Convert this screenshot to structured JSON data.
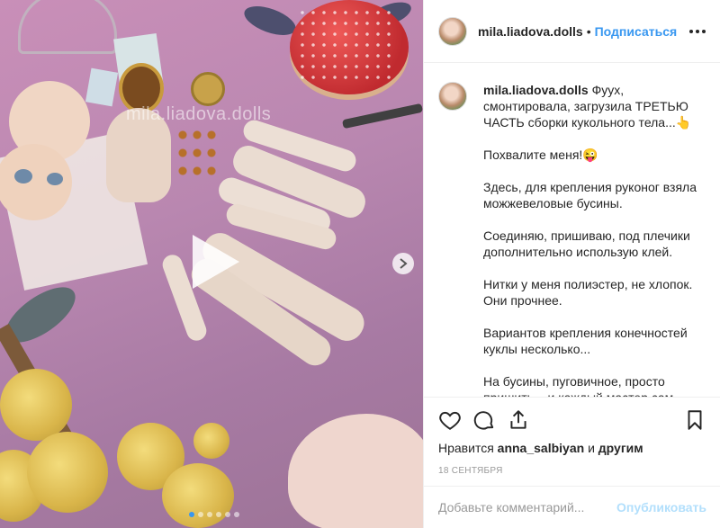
{
  "post": {
    "username": "mila.liadova.dolls",
    "separator": "•",
    "follow_label": "Подписаться",
    "more_icon": "more-horizontal-icon"
  },
  "media": {
    "watermark": "mila.liadova.dolls",
    "play_icon": "play-icon",
    "next_icon": "chevron-right-icon",
    "carousel_dots": 6,
    "active_dot": 1
  },
  "caption": {
    "username": "mila.liadova.dolls",
    "paragraphs": [
      "Фуух, смонтировала, загрузила ТРЕТЬЮ ЧАСТЬ сборки кукольного тела...👆",
      "Похвалите меня!😜",
      "Здесь, для крепления руконог взяла можжевеловые бусины.",
      "Соединяю, пришиваю, под плечики дополнительно использую клей.",
      "Нитки у меня полиэстер, не хлопок. Они прочнее.",
      "Вариантов крепления конечностей куклы несколько...",
      "На бусины, пуговичное, просто пришить... и каждый мастер сам"
    ]
  },
  "actions": {
    "like_icon": "heart-icon",
    "comment_icon": "comment-icon",
    "share_icon": "share-icon",
    "save_icon": "bookmark-icon"
  },
  "likes": {
    "prefix": "Нравится",
    "user": "anna_salbiyan",
    "connector": "и",
    "others": "другим"
  },
  "date": "18 сентября",
  "comment": {
    "placeholder": "Добавьте комментарий...",
    "publish_label": "Опубликовать"
  }
}
